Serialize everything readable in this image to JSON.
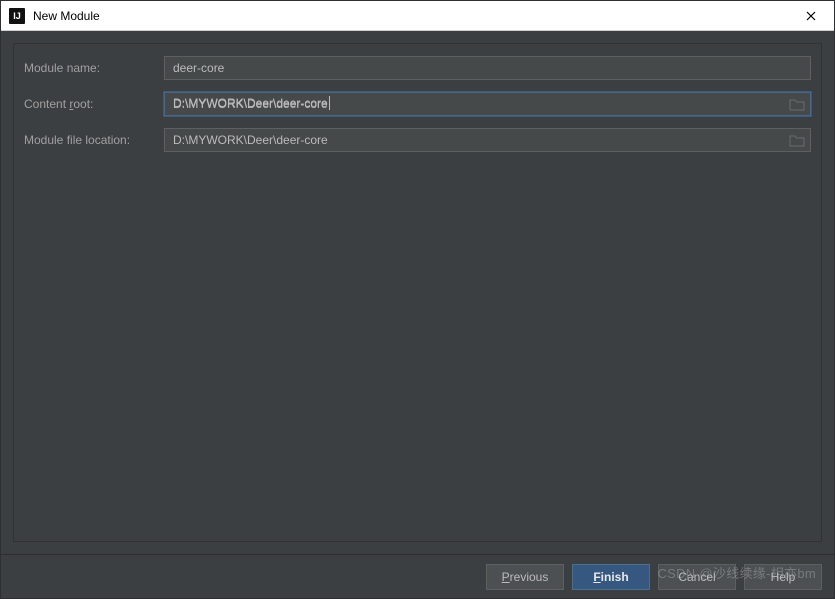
{
  "window": {
    "title": "New Module"
  },
  "form": {
    "module_name_label": "Module name:",
    "module_name_value": "deer-core",
    "content_root_label_pre": "Content ",
    "content_root_label_mn": "r",
    "content_root_label_post": "oot:",
    "content_root_value": "D:\\MYWORK\\Deer\\deer-core",
    "module_file_loc_label": "Module file location:",
    "module_file_loc_value": "D:\\MYWORK\\Deer\\deer-core"
  },
  "buttons": {
    "previous_mn": "P",
    "previous_rest": "revious",
    "finish_mn": "F",
    "finish_rest": "inish",
    "cancel": "Cancel",
    "help": "Help"
  },
  "watermark": "CSDN @沙线续缘-相亦bm"
}
